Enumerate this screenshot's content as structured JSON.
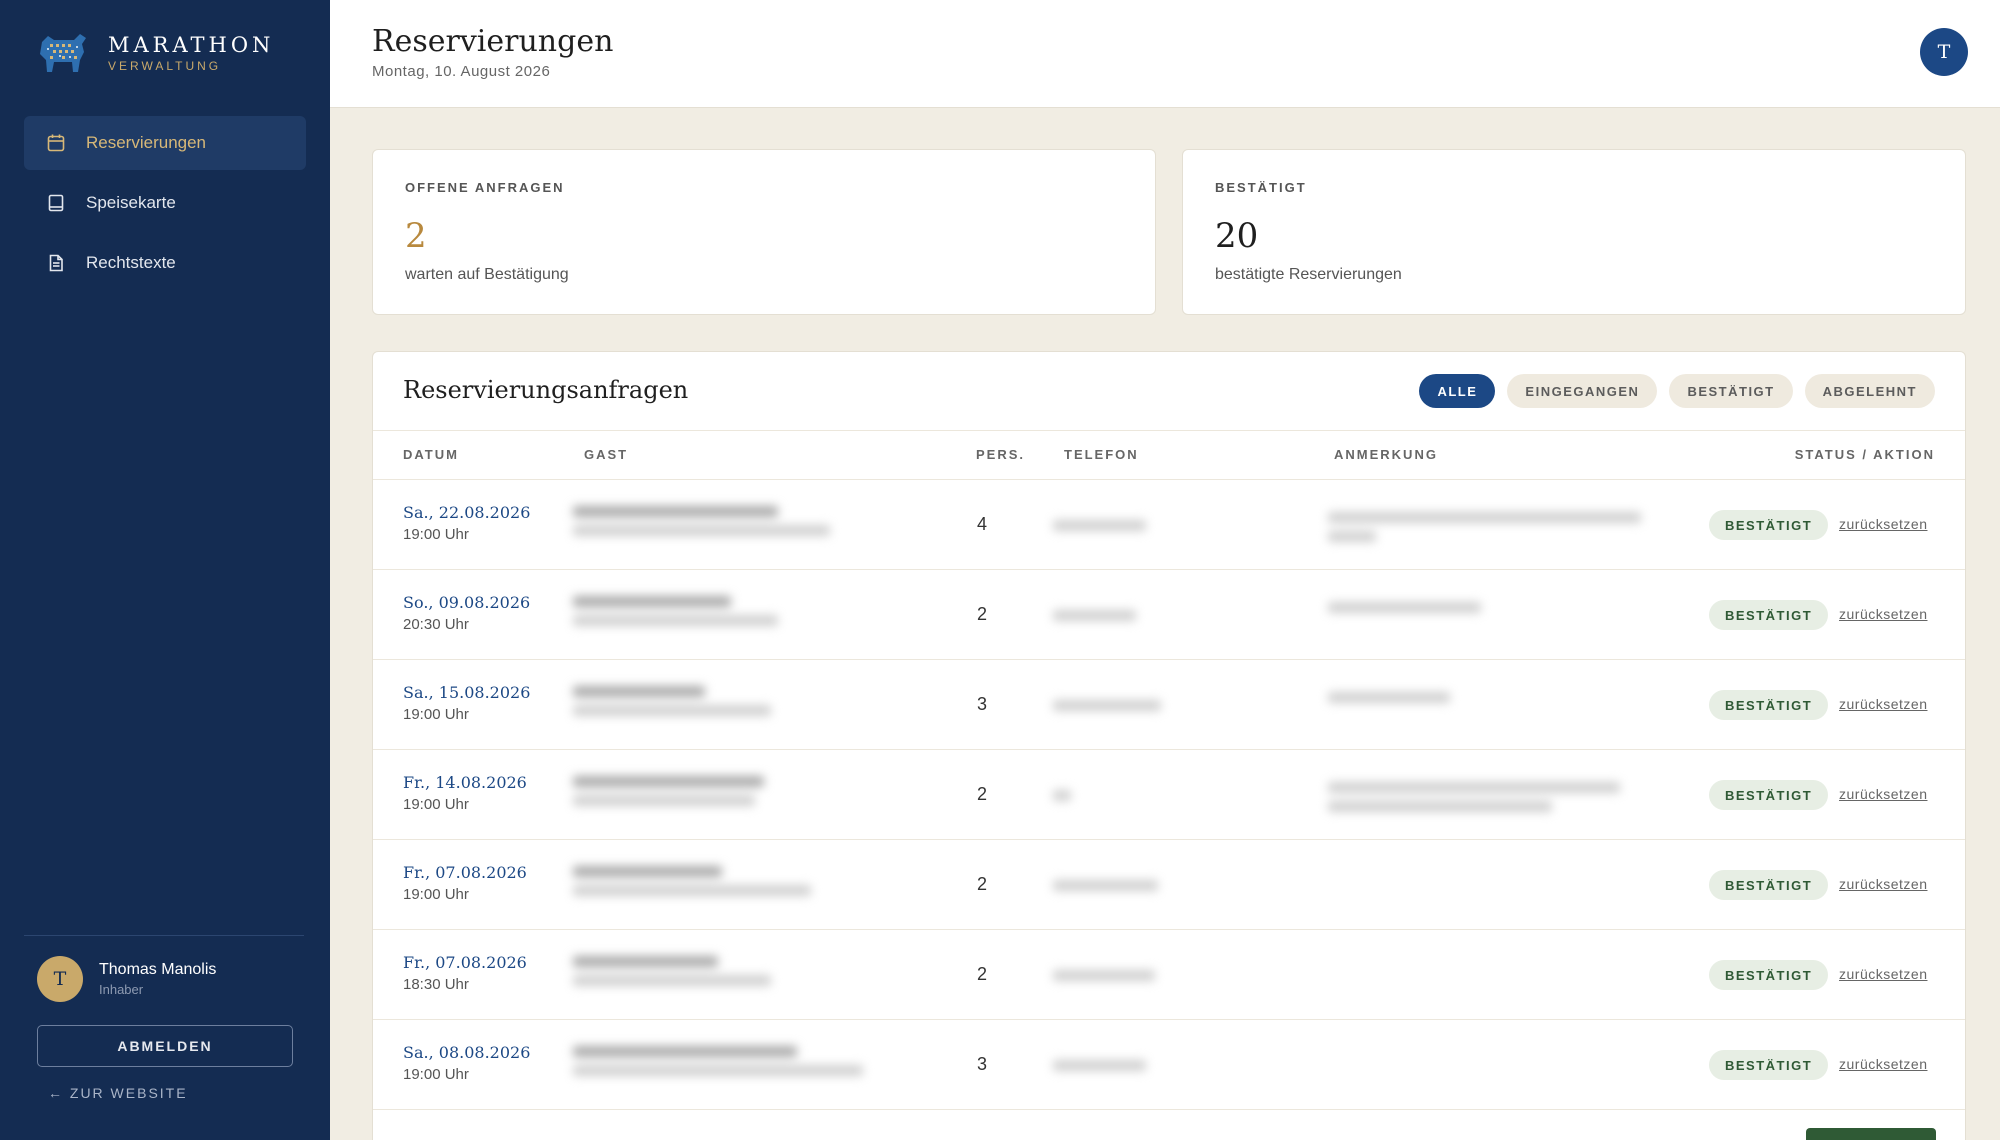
{
  "brand": {
    "name": "MARATHON",
    "subtitle": "VERWALTUNG"
  },
  "sidebar": {
    "items": [
      {
        "label": "Reservierungen",
        "icon": "calendar-icon",
        "active": true
      },
      {
        "label": "Speisekarte",
        "icon": "book-icon",
        "active": false
      },
      {
        "label": "Rechtstexte",
        "icon": "document-icon",
        "active": false
      }
    ],
    "user": {
      "initial": "T",
      "name": "Thomas Manolis",
      "role": "Inhaber"
    },
    "logout_label": "ABMELDEN",
    "website_label": "← ZUR WEBSITE"
  },
  "header": {
    "title": "Reservierungen",
    "date": "Montag, 10. August 2026",
    "avatar_initial": "T"
  },
  "stats": [
    {
      "label": "OFFENE ANFRAGEN",
      "value": "2",
      "sub": "warten auf Bestätigung",
      "color": "#b8893e"
    },
    {
      "label": "BESTÄTIGT",
      "value": "20",
      "sub": "bestätigte Reservierungen",
      "color": "#1f1f1f"
    }
  ],
  "table": {
    "title": "Reservierungsanfragen",
    "filters": [
      {
        "label": "ALLE",
        "active": true
      },
      {
        "label": "EINGEGANGEN",
        "active": false
      },
      {
        "label": "BESTÄTIGT",
        "active": false
      },
      {
        "label": "ABGELEHNT",
        "active": false
      }
    ],
    "columns": [
      "DATUM",
      "GAST",
      "PERS.",
      "TELEFON",
      "ANMERKUNG",
      "STATUS / AKTION"
    ],
    "rows": [
      {
        "date": "Sa., 22.08.2026",
        "time": "19:00 Uhr",
        "persons": "4",
        "status": "BESTÄTIGT",
        "action": "zurücksetzen"
      },
      {
        "date": "So., 09.08.2026",
        "time": "20:30 Uhr",
        "persons": "2",
        "status": "BESTÄTIGT",
        "action": "zurücksetzen"
      },
      {
        "date": "Sa., 15.08.2026",
        "time": "19:00 Uhr",
        "persons": "3",
        "status": "BESTÄTIGT",
        "action": "zurücksetzen"
      },
      {
        "date": "Fr., 14.08.2026",
        "time": "19:00 Uhr",
        "persons": "2",
        "status": "BESTÄTIGT",
        "action": "zurücksetzen"
      },
      {
        "date": "Fr., 07.08.2026",
        "time": "19:00 Uhr",
        "persons": "2",
        "status": "BESTÄTIGT",
        "action": "zurücksetzen"
      },
      {
        "date": "Fr., 07.08.2026",
        "time": "18:30 Uhr",
        "persons": "2",
        "status": "BESTÄTIGT",
        "action": "zurücksetzen"
      },
      {
        "date": "Sa., 08.08.2026",
        "time": "19:00 Uhr",
        "persons": "3",
        "status": "BESTÄTIGT",
        "action": "zurücksetzen"
      }
    ]
  }
}
